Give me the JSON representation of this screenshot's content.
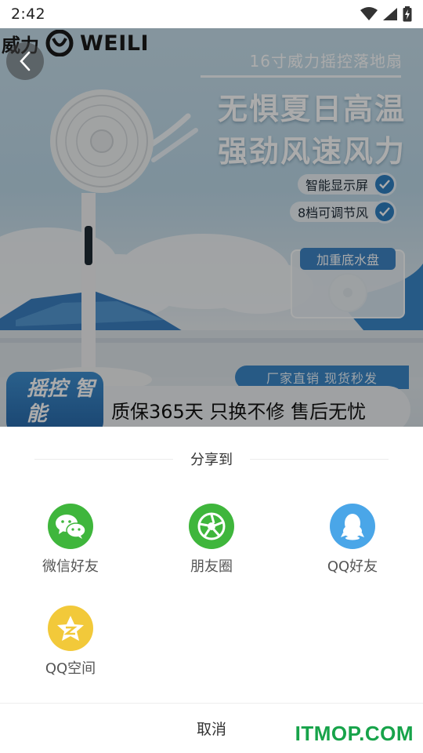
{
  "status_bar": {
    "time": "2:42",
    "icons": [
      "wifi-icon",
      "cell-signal-icon",
      "battery-icon"
    ]
  },
  "banner": {
    "brand": {
      "cn": "威力",
      "en": "WEILI"
    },
    "product_subtitle": "16寸威力摇控落地扇",
    "headline_line1": "无惧夏日高温",
    "headline_line2": "强劲风速风力",
    "features": [
      "智能显示屏",
      "8档可调节风"
    ],
    "water_base_label": "加重底水盘",
    "promo_tag": "厂家直销 现货秒发",
    "swing_badge": "摇控 智能",
    "guarantee": "质保365天 只换不修 售后无忧",
    "carousel": {
      "count": 10,
      "active_index": 0
    }
  },
  "share_sheet": {
    "title": "分享到",
    "targets": [
      {
        "label": "微信好友",
        "icon": "wechat-icon",
        "color": "#3fb63c"
      },
      {
        "label": "朋友圈",
        "icon": "moments-icon",
        "color": "#3fb63c"
      },
      {
        "label": "QQ好友",
        "icon": "qq-icon",
        "color": "#4aa6e8"
      },
      {
        "label": "QQ空间",
        "icon": "qzone-icon",
        "color": "#f2c93a"
      }
    ],
    "cancel": "取消"
  },
  "watermark": "ITMOP.COM",
  "colors": {
    "wechat_green": "#3fb63c",
    "qq_blue": "#4aa6e8",
    "qzone_yellow": "#f2c93a",
    "watermark_green": "#17a34a",
    "banner_blue": "#3b86c7"
  }
}
